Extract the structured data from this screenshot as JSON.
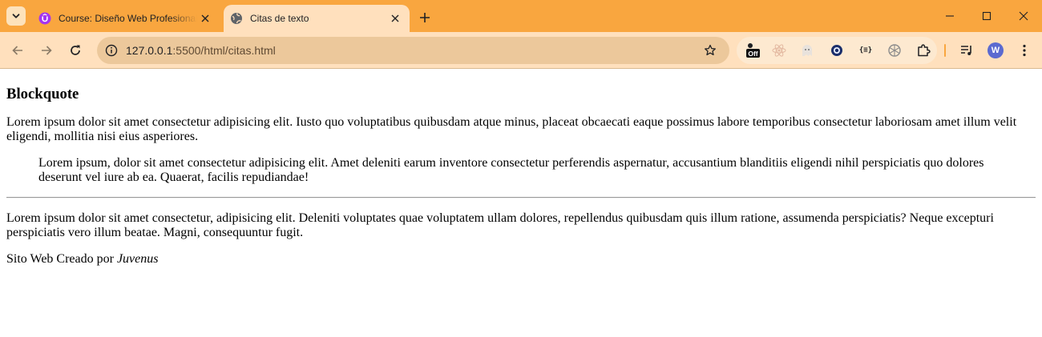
{
  "browser": {
    "tabs": [
      {
        "title": "Course: Diseño Web Profesional",
        "favicon": "udemy-icon",
        "active": false
      },
      {
        "title": "Citas de texto",
        "favicon": "globe-icon",
        "active": true
      }
    ],
    "address_bar": {
      "host": "127.0.0.1",
      "path": ":5500/html/citas.html"
    },
    "extensions": [
      "off-badge-extension-icon",
      "react-devtools-icon",
      "ghost-extension-icon",
      "blue-shield-extension-icon",
      "json-viewer-icon",
      "chatgpt-icon",
      "extensions-puzzle-icon"
    ],
    "extension_badge": "Off",
    "json_ext_label": "{≡}",
    "profile_initial": "W",
    "colors": {
      "frame": "#f9a63f",
      "toolbar": "#ffe0bd",
      "omnibox": "#ecc89b",
      "profile": "#5b6ad0"
    }
  },
  "page": {
    "heading": "Blockquote",
    "paragraph1": "Lorem ipsum dolor sit amet consectetur adipisicing elit. Iusto quo voluptatibus quibusdam atque minus, placeat obcaecati eaque possimus labore temporibus consectetur laboriosam amet illum velit eligendi, mollitia nisi eius asperiores.",
    "blockquote": "Lorem ipsum, dolor sit amet consectetur adipisicing elit. Amet deleniti earum inventore consectetur perferendis aspernatur, accusantium blanditiis eligendi nihil perspiciatis quo dolores deserunt vel iure ab ea. Quaerat, facilis repudiandae!",
    "paragraph2": "Lorem ipsum dolor sit amet consectetur, adipisicing elit. Deleniti voluptates quae voluptatem ullam dolores, repellendus quibusdam quis illum ratione, assumenda perspiciatis? Neque excepturi perspiciatis vero illum beatae. Magni, consequuntur fugit.",
    "footer_prefix": "Sito Web Creado por ",
    "footer_author": "Juvenus"
  }
}
